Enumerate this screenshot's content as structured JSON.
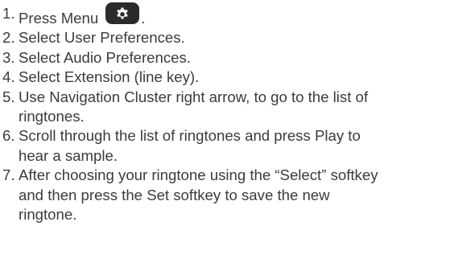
{
  "instructions": {
    "steps": [
      {
        "number": "1.",
        "lines": [
          "Press Menu"
        ],
        "suffix": "."
      },
      {
        "number": "2.",
        "lines": [
          "Select User Preferences."
        ]
      },
      {
        "number": "3.",
        "lines": [
          "Select Audio Preferences."
        ]
      },
      {
        "number": "4.",
        "lines": [
          "Select Extension (line key)."
        ]
      },
      {
        "number": "5.",
        "lines": [
          "Use Navigation Cluster right arrow, to go to the list of",
          "ringtones."
        ]
      },
      {
        "number": "6.",
        "lines": [
          "Scroll through the list of ringtones and press Play to",
          "hear a sample."
        ]
      },
      {
        "number": "7.",
        "lines": [
          "After choosing your ringtone using the “Select” softkey",
          "and then press the Set softkey to save the new",
          "ringtone."
        ]
      }
    ],
    "menu_key_icon": "gear-icon",
    "colors": {
      "text": "#3b3b3b",
      "key_background": "#2b2b2b",
      "key_icon": "#ffffff"
    }
  }
}
